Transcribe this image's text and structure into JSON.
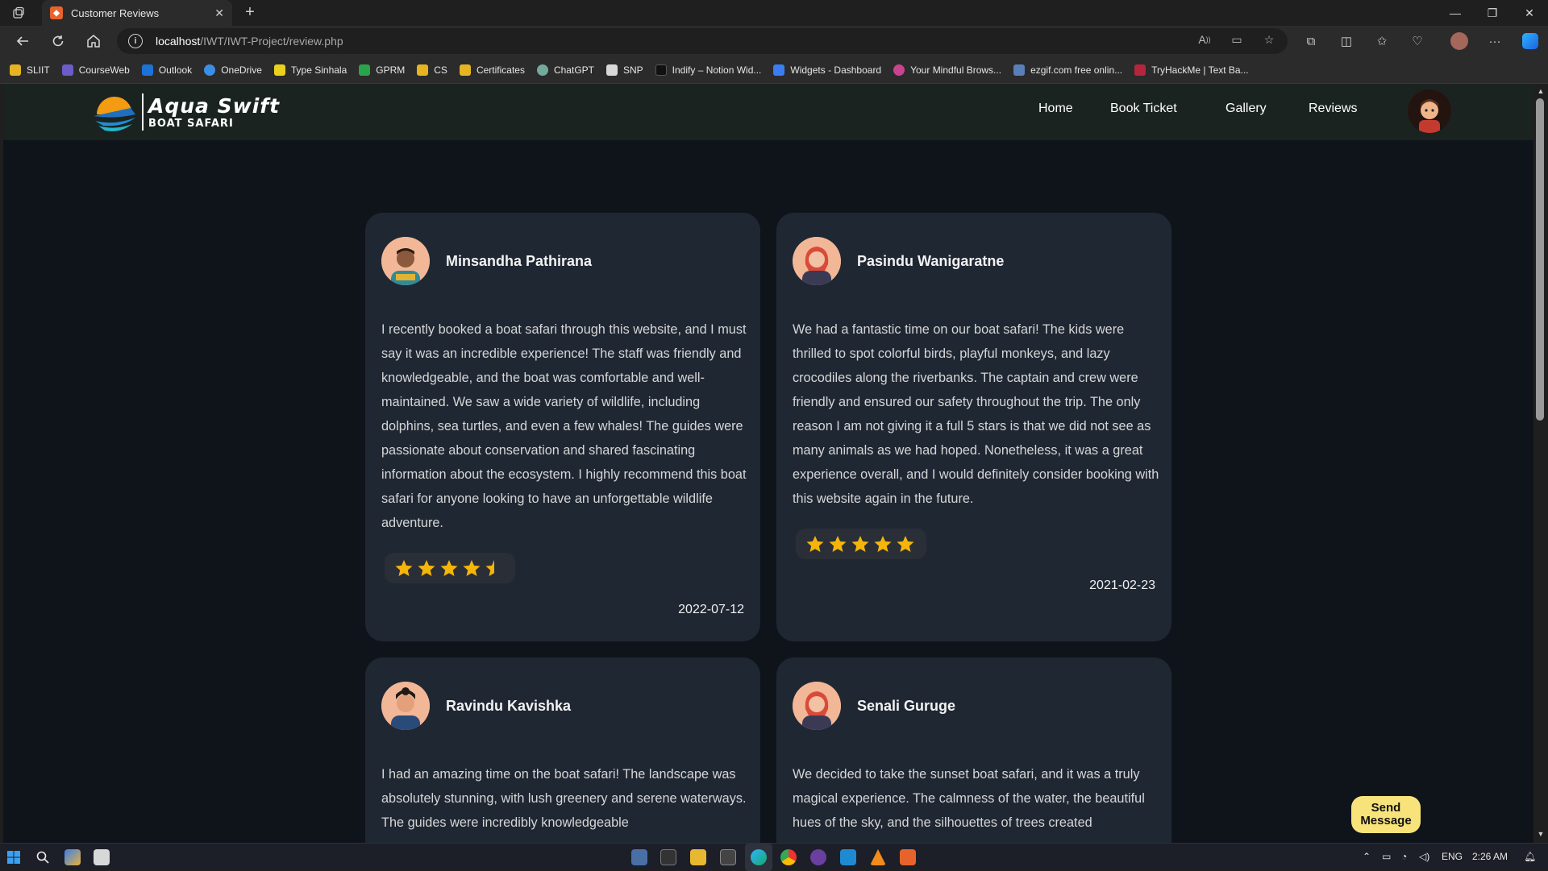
{
  "browser": {
    "tab_title": "Customer Reviews",
    "url_host": "localhost",
    "url_path": "/IWT/IWT-Project/review.php",
    "bookmarks": [
      "SLIIT",
      "CourseWeb",
      "Outlook",
      "OneDrive",
      "Type Sinhala",
      "GPRM",
      "CS",
      "Certificates",
      "ChatGPT",
      "SNP",
      "Indify – Notion Wid...",
      "Widgets - Dashboard",
      "Your Mindful Brows...",
      "ezgif.com free onlin...",
      "TryHackMe | Text Ba..."
    ]
  },
  "site": {
    "logo_title": "Aqua Swift",
    "logo_subtitle": "BOAT SAFARI",
    "nav": [
      "Home",
      "Book Ticket",
      "Gallery",
      "Reviews"
    ]
  },
  "reviews": [
    {
      "name": "Minsandha Pathirana",
      "text": "I recently booked a boat safari through this website, and I must say it was an incredible experience! The staff was friendly and knowledgeable, and the boat was comfortable and well-maintained. We saw a wide variety of wildlife, including dolphins, sea turtles, and even a few whales! The guides were passionate about conservation and shared fascinating information about the ecosystem. I highly recommend this boat safari for anyone looking to have an unforgettable wildlife adventure.",
      "rating": 4.5,
      "date": "2022-07-12"
    },
    {
      "name": "Pasindu Wanigaratne",
      "text": "We had a fantastic time on our boat safari! The kids were thrilled to spot colorful birds, playful monkeys, and lazy crocodiles along the riverbanks. The captain and crew were friendly and ensured our safety throughout the trip. The only reason I am not giving it a full 5 stars is that we did not see as many animals as we had hoped. Nonetheless, it was a great experience overall, and I would definitely consider booking with this website again in the future.",
      "rating": 5,
      "date": "2021-02-23"
    },
    {
      "name": "Ravindu Kavishka",
      "text": "I had an amazing time on the boat safari! The landscape was absolutely stunning, with lush greenery and serene waterways. The guides were incredibly knowledgeable"
    },
    {
      "name": "Senali Guruge",
      "text": "We decided to take the sunset boat safari, and it was a truly magical experience. The calmness of the water, the beautiful hues of the sky, and the silhouettes of trees created"
    }
  ],
  "send_message": "Send Message",
  "taskbar": {
    "lang": "ENG",
    "time": "2:26 AM"
  },
  "colors": {
    "star": "#f5b50a",
    "card": "#1f2733",
    "page_bg": "#0f141b",
    "header_bg": "#1a2320",
    "send_btn": "#f7e37a"
  }
}
